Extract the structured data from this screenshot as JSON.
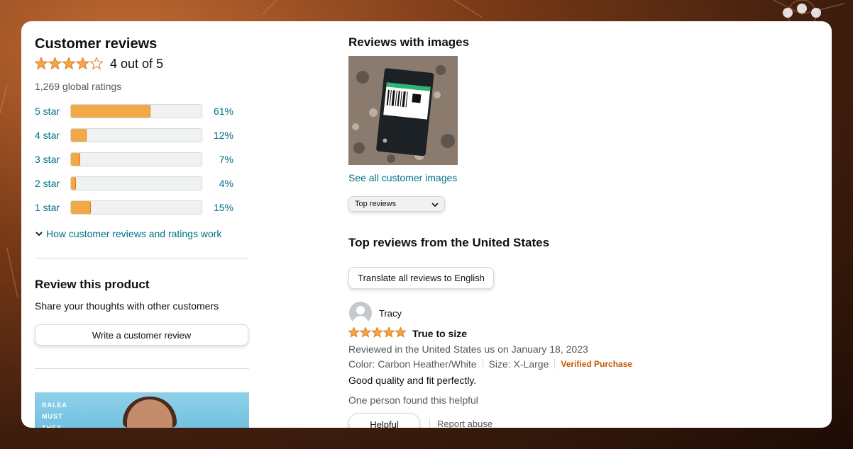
{
  "colors": {
    "star": "#f3a847",
    "star_outline": "#de7921",
    "link": "#007185",
    "bar_fill": "#f3a847",
    "verified": "#c45500"
  },
  "summary": {
    "title": "Customer reviews",
    "rating_value": 4,
    "rating_max": 5,
    "rating_text": "4 out of 5",
    "global_ratings": "1,269 global ratings"
  },
  "histogram": [
    {
      "label": "5 star",
      "percent": 61,
      "percent_text": "61%"
    },
    {
      "label": "4 star",
      "percent": 12,
      "percent_text": "12%"
    },
    {
      "label": "3 star",
      "percent": 7,
      "percent_text": "7%"
    },
    {
      "label": "2 star",
      "percent": 4,
      "percent_text": "4%"
    },
    {
      "label": "1 star",
      "percent": 15,
      "percent_text": "15%"
    }
  ],
  "how_link": "How customer reviews and ratings work",
  "review_product": {
    "title": "Review this product",
    "subtitle": "Share your thoughts with other customers",
    "button": "Write a customer review"
  },
  "promo": {
    "text_lines": [
      "BALEA",
      "MUST",
      "THEY"
    ]
  },
  "images_section": {
    "title": "Reviews with images",
    "see_all": "See all customer images"
  },
  "sort": {
    "selected": "Top reviews"
  },
  "top_reviews": {
    "title": "Top reviews from the United States",
    "translate_button": "Translate all reviews to English"
  },
  "review": {
    "reviewer": "Tracy",
    "stars": 5,
    "title": "True to size",
    "date_line": "Reviewed in the United States us on January 18, 2023",
    "color": "Color: Carbon Heather/White",
    "size": "Size: X-Large",
    "verified": "Verified Purchase",
    "body": "Good quality and fit perfectly.",
    "helpful_count": "One person found this helpful",
    "helpful_button": "Helpful",
    "report": "Report abuse"
  }
}
